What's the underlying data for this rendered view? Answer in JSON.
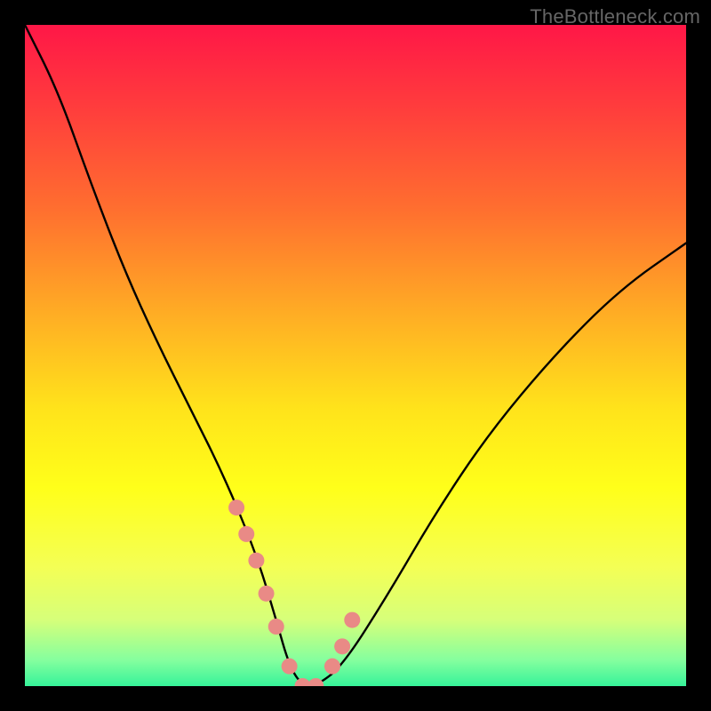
{
  "watermark": "TheBottleneck.com",
  "accent_marker_color": "#e98a86",
  "curve_color": "#000000",
  "frame_color": "#000000",
  "gradient_stops": [
    {
      "offset": 0.0,
      "color": "#ff1747"
    },
    {
      "offset": 0.12,
      "color": "#ff3b3d"
    },
    {
      "offset": 0.28,
      "color": "#ff6f2f"
    },
    {
      "offset": 0.44,
      "color": "#ffae24"
    },
    {
      "offset": 0.58,
      "color": "#ffe31b"
    },
    {
      "offset": 0.7,
      "color": "#ffff1a"
    },
    {
      "offset": 0.82,
      "color": "#f4ff55"
    },
    {
      "offset": 0.9,
      "color": "#d6ff7a"
    },
    {
      "offset": 0.96,
      "color": "#86ff9e"
    },
    {
      "offset": 1.0,
      "color": "#36f39a"
    }
  ],
  "chart_data": {
    "type": "line",
    "title": "",
    "xlabel": "",
    "ylabel": "",
    "xlim": [
      0,
      100
    ],
    "ylim": [
      0,
      100
    ],
    "series": [
      {
        "name": "bottleneck-curve",
        "x": [
          0,
          5,
          10,
          15,
          20,
          25,
          30,
          35,
          38,
          40,
          42,
          44,
          48,
          55,
          62,
          70,
          80,
          90,
          100
        ],
        "y": [
          100,
          90,
          76,
          63,
          52,
          42,
          32,
          20,
          10,
          3,
          0,
          0,
          3,
          14,
          26,
          38,
          50,
          60,
          67
        ]
      }
    ],
    "markers": {
      "name": "highlight-markers",
      "x": [
        32,
        33.5,
        35,
        36.5,
        38,
        40,
        42,
        44,
        46.5,
        48,
        49.5
      ],
      "y": [
        27,
        23,
        19,
        14,
        9,
        3,
        0,
        0,
        3,
        6,
        10
      ]
    }
  }
}
